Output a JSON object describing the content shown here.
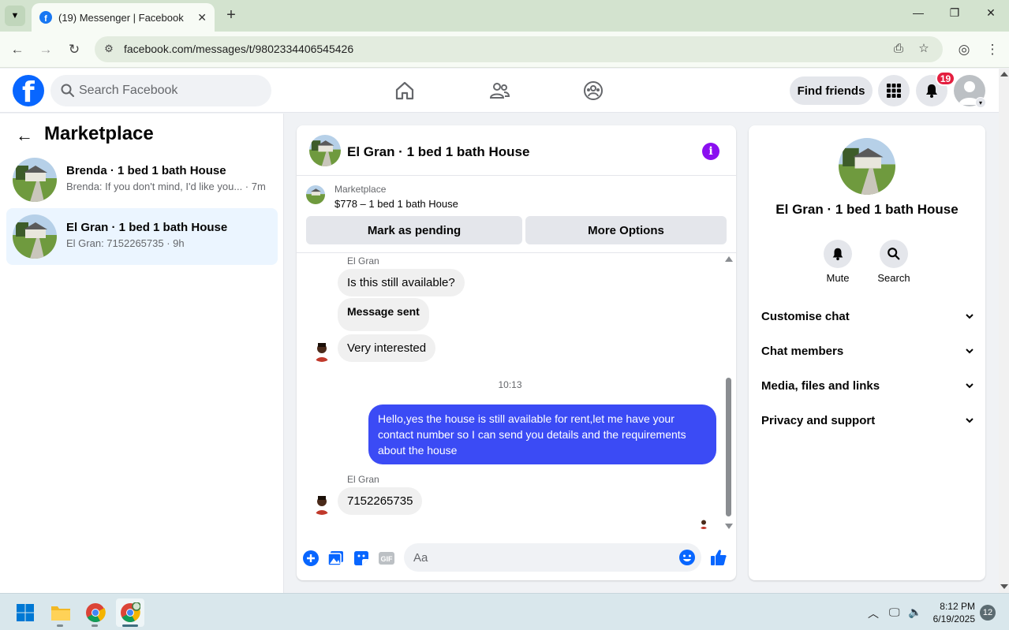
{
  "browser": {
    "tab_title": "(19) Messenger | Facebook",
    "url": "facebook.com/messages/t/9802334406545426"
  },
  "header": {
    "search_placeholder": "Search Facebook",
    "find_friends": "Find friends",
    "notification_count": "19"
  },
  "sidebar": {
    "title": "Marketplace",
    "conversations": [
      {
        "title": "Brenda · 1 bed 1 bath House",
        "subtitle": "Brenda: If you don't mind, I'd like you... · 7m",
        "active": false
      },
      {
        "title": "El Gran · 1 bed 1 bath House",
        "subtitle": "El Gran: 7152265735 · 9h",
        "active": true
      }
    ]
  },
  "chat": {
    "title": "El Gran · 1 bed 1 bath House",
    "listing": {
      "category": "Marketplace",
      "price_title": "$778 – 1 bed 1 bath House",
      "mark_pending": "Mark as pending",
      "more_options": "More Options"
    },
    "messages": {
      "sender1": "El Gran",
      "m1": "Is this still available?",
      "m2": "Message sent",
      "m3": "Very interested",
      "time": "10:13",
      "out1": "Hello,yes the house is still available for rent,let me have your contact number   so I can send you details and the requirements about the house",
      "sender2": "El Gran",
      "m4": "7152265735"
    },
    "composer_placeholder": "Aa"
  },
  "details": {
    "title": "El Gran · 1 bed 1 bath House",
    "mute": "Mute",
    "search": "Search",
    "rows": [
      "Customise chat",
      "Chat members",
      "Media, files and links",
      "Privacy and support"
    ]
  },
  "taskbar": {
    "time": "8:12 PM",
    "date": "6/19/2025",
    "badge": "12"
  },
  "colors": {
    "fb_blue": "#0866ff",
    "outgoing_bubble": "#3b4bf5",
    "active_conversation": "#ebf5ff",
    "notification_badge": "#e41e3f",
    "info_icon": "#8a0ff0"
  }
}
